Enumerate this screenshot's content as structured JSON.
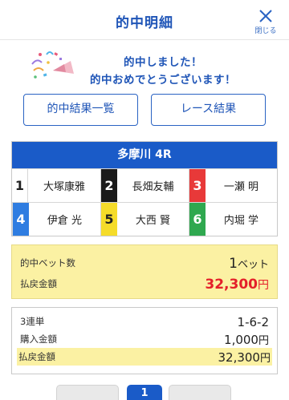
{
  "header": {
    "title": "的中明細",
    "close_label": "閉じる"
  },
  "hit": {
    "line1": "的中しました！",
    "line2": "的中おめでとうございます！"
  },
  "buttons": {
    "result_list": "的中結果一覧",
    "race_result": "レース結果"
  },
  "race": {
    "title": "多摩川 4R",
    "racers": [
      {
        "number": "1",
        "name": "大塚康雅"
      },
      {
        "number": "2",
        "name": "長畑友輔"
      },
      {
        "number": "3",
        "name": "一瀬 明"
      },
      {
        "number": "4",
        "name": "伊倉 光"
      },
      {
        "number": "5",
        "name": "大西 賢"
      },
      {
        "number": "6",
        "name": "内堀 学"
      }
    ]
  },
  "summary": {
    "hit_bets_label": "的中ベット数",
    "hit_bets_value": "1",
    "hit_bets_unit": "ベット",
    "payout_label": "払戻金額",
    "payout_value": "32,300",
    "payout_unit": "円"
  },
  "detail": {
    "bet_type": "3連単",
    "combination": "1-6-2",
    "purchase_label": "購入金額",
    "purchase_value": "1,000",
    "purchase_unit": "円",
    "payout_label": "払戻金額",
    "payout_value": "32,300",
    "payout_unit": "円"
  },
  "pager": {
    "current": "1"
  }
}
